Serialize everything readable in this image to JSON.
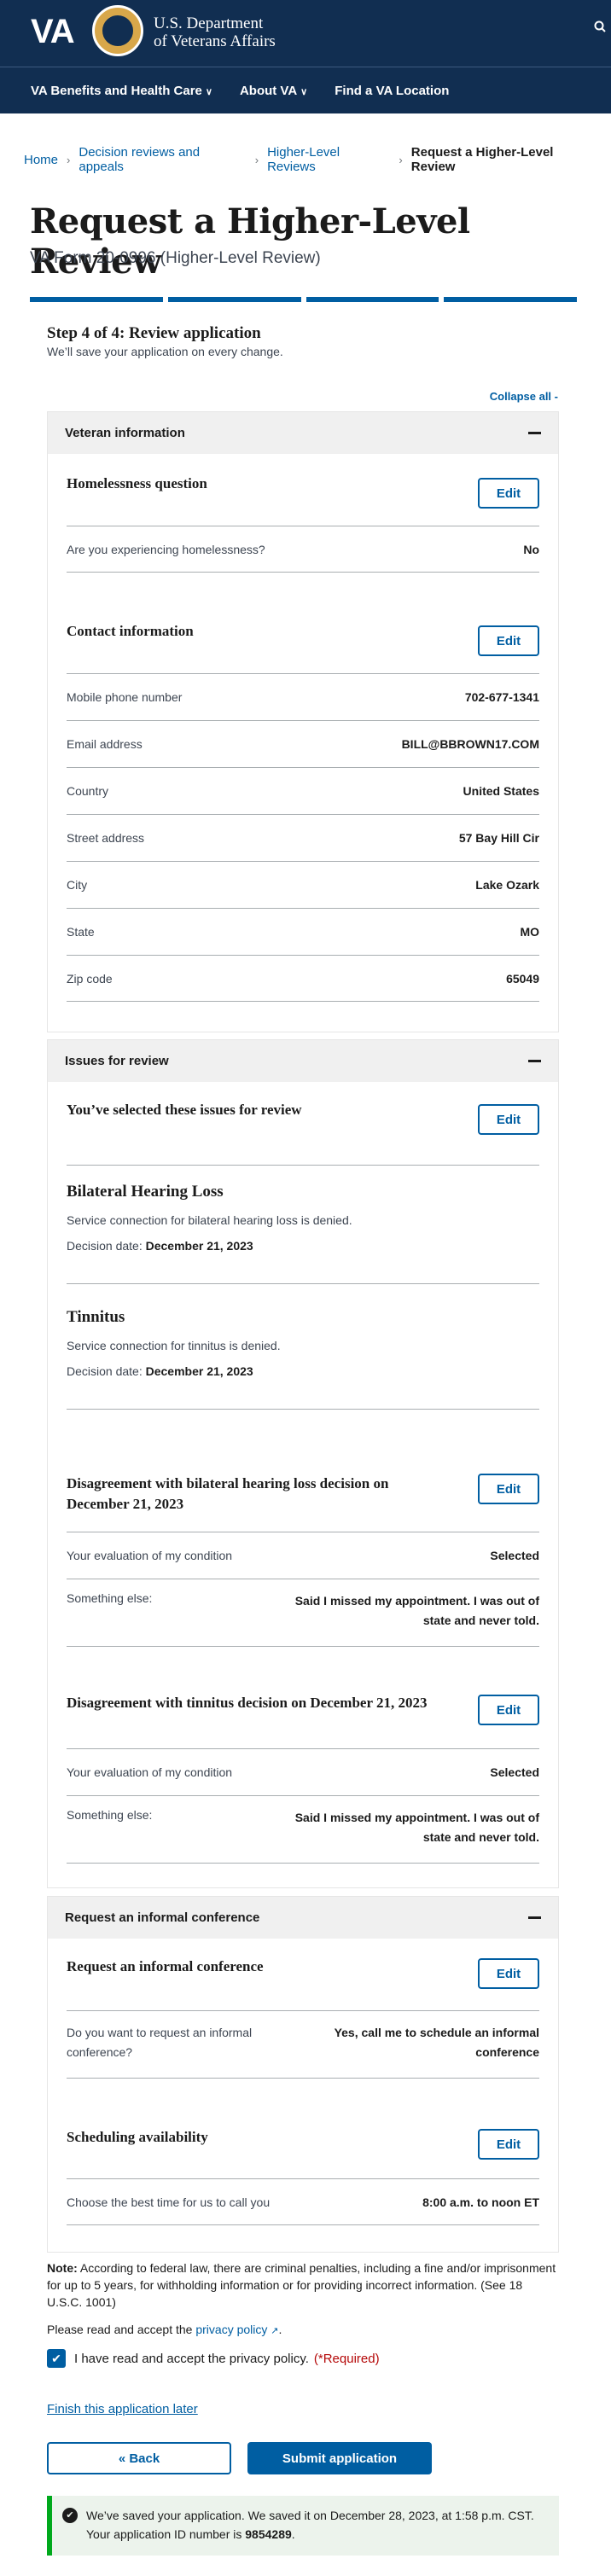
{
  "header": {
    "logo_text": "VA",
    "department": [
      "U.S. Department",
      "of Veterans Affairs"
    ],
    "nav": [
      "VA Benefits and Health Care",
      "About VA",
      "Find a VA Location"
    ]
  },
  "breadcrumbs": [
    "Home",
    "Decision reviews and appeals",
    "Higher-Level Reviews",
    "Request a Higher-Level Review"
  ],
  "page": {
    "title": "Request a Higher-Level Review",
    "subtitle": "VA Form 20-0996 (Higher-Level Review)",
    "step": "Step 4 of 4: Review application",
    "save_note": "We’ll save your application on every change.",
    "collapse_all": "Collapse all -"
  },
  "edit_label": "Edit",
  "veteran": {
    "heading": "Veteran information",
    "homeless_title": "Homelessness question",
    "homeless_q": "Are you experiencing homelessness?",
    "homeless_a": "No",
    "contact_title": "Contact information",
    "rows": [
      {
        "label": "Mobile phone number",
        "value": "702-677-1341"
      },
      {
        "label": "Email address",
        "value": "BILL@BBROWN17.COM"
      },
      {
        "label": "Country",
        "value": "United States"
      },
      {
        "label": "Street address",
        "value": "57 Bay Hill Cir"
      },
      {
        "label": "City",
        "value": "Lake Ozark"
      },
      {
        "label": "State",
        "value": "MO"
      },
      {
        "label": "Zip code",
        "value": "65049"
      }
    ]
  },
  "issues": {
    "heading": "Issues for review",
    "selected_title": "You’ve selected these issues for review",
    "list": [
      {
        "name": "Bilateral Hearing Loss",
        "desc": "Service connection for bilateral hearing loss is denied.",
        "date_label": "Decision date:",
        "date": "December 21, 2023"
      },
      {
        "name": "Tinnitus",
        "desc": "Service connection for tinnitus is denied.",
        "date_label": "Decision date:",
        "date": "December 21, 2023"
      }
    ],
    "disagreements": [
      {
        "title": "Disagreement with bilateral hearing loss decision on December 21, 2023",
        "eval_label": "Your evaluation of my condition",
        "eval_value": "Selected",
        "else_label": "Something else:",
        "else_value": "Said I missed my appointment. I was out of state and never told."
      },
      {
        "title": "Disagreement with tinnitus decision on December 21, 2023",
        "eval_label": "Your evaluation of my condition",
        "eval_value": "Selected",
        "else_label": "Something else:",
        "else_value": "Said I missed my appointment. I was out of state and never told."
      }
    ]
  },
  "conference": {
    "heading": "Request an informal conference",
    "sub_title": "Request an informal conference",
    "q": "Do you want to request an informal conference?",
    "a": "Yes, call me to schedule an informal conference",
    "sched_title": "Scheduling availability",
    "sched_q": "Choose the best time for us to call you",
    "sched_a": "8:00 a.m. to noon ET"
  },
  "footer": {
    "note_label": "Note:",
    "note_text": "According to federal law, there are criminal penalties, including a fine and/or imprisonment for up to 5 years, for withholding information or for providing incorrect information. (See 18 U.S.C. 1001)",
    "privacy_prefix": "Please read and accept the",
    "privacy_link": "privacy policy",
    "privacy_suffix": ".",
    "checkbox_label": "I have read and accept the privacy policy.",
    "required": "(*Required)",
    "finish_later": "Finish this application later",
    "back": "« Back",
    "submit": "Submit application",
    "alert_line1": "We’ve saved your application. We saved it on December 28, 2023, at 1:58 p.m. CST.",
    "alert_line2_prefix": "Your application ID number is",
    "alert_id": "9854289",
    "alert_line2_suffix": "."
  },
  "colors": {
    "header": "#112e51",
    "primary": "#005ea2",
    "success": "#00a91c",
    "required": "#b50909"
  }
}
